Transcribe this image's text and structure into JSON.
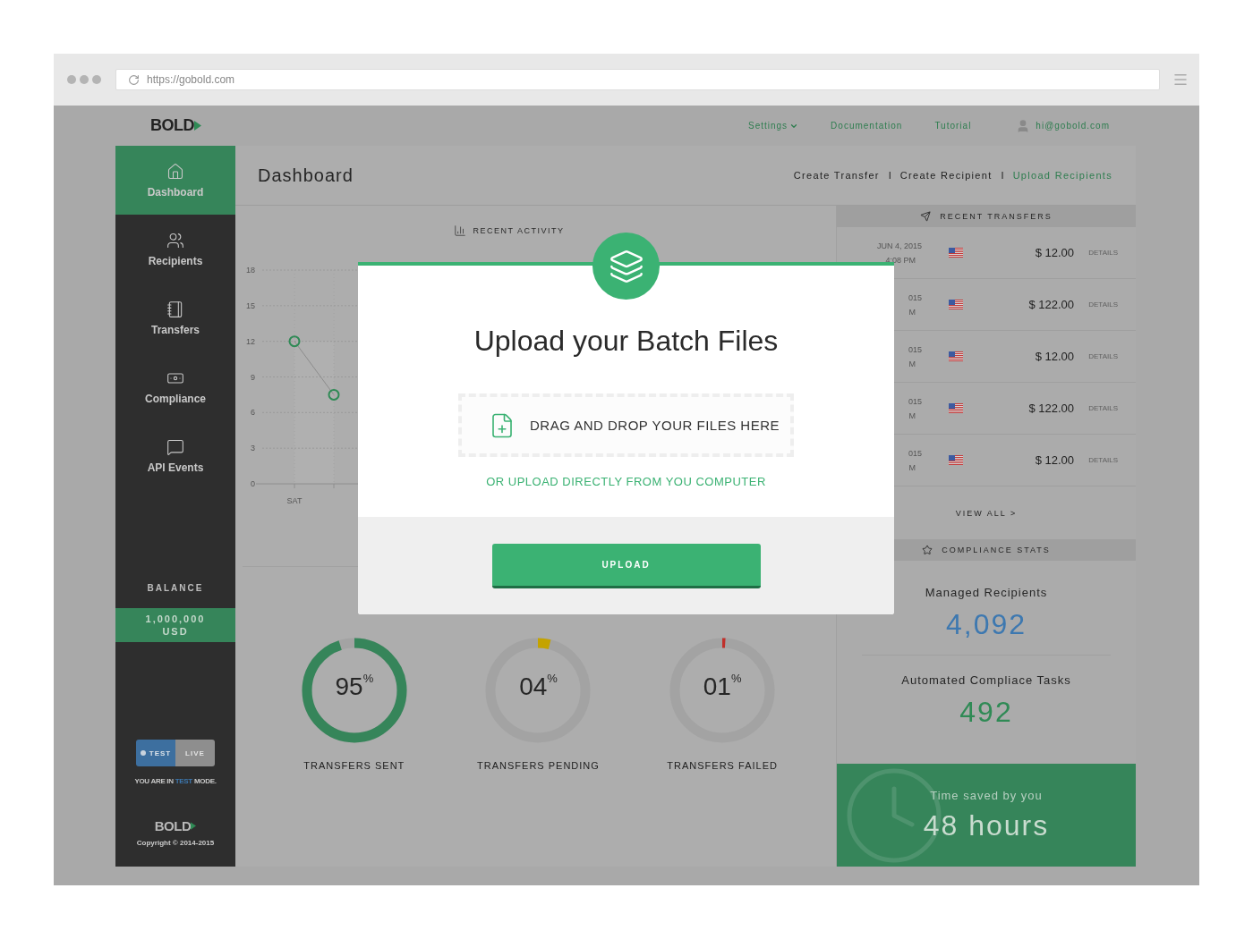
{
  "browser": {
    "url": "https://gobold.com"
  },
  "topbar": {
    "logo": "BOLD",
    "links": [
      {
        "label": "Settings",
        "kind": "dropdown"
      },
      {
        "label": "Documentation",
        "kind": "link"
      },
      {
        "label": "Tutorial",
        "kind": "link"
      }
    ],
    "user": "hi@gobold.com"
  },
  "sidebar": {
    "items": [
      {
        "label": "Dashboard",
        "selected": true
      },
      {
        "label": "Recipients",
        "selected": false
      },
      {
        "label": "Transfers",
        "selected": false
      },
      {
        "label": "Compliance",
        "selected": false
      },
      {
        "label": "API Events",
        "selected": false
      }
    ],
    "balance_label": "BALANCE",
    "balance_value": "1,000,000",
    "balance_currency": "USD",
    "mode_toggle": [
      {
        "label": "TEST",
        "selected": true
      },
      {
        "label": "LIVE",
        "selected": false
      }
    ],
    "mode_text": {
      "before": "YOU ARE IN ",
      "highlight": "TEST",
      "after": " MODE."
    },
    "footer_logo": "BOLD",
    "copyright": "Copyright © 2014-2015"
  },
  "header": {
    "title": "Dashboard",
    "separators": [
      "I",
      "I"
    ],
    "actions": [
      {
        "label": "Create Transfer",
        "selected": false
      },
      {
        "label": "Create Recipient",
        "selected": false
      },
      {
        "label": "Upload Recipients",
        "selected": true
      }
    ]
  },
  "activity": {
    "title": "RECENT ACTIVITY",
    "y_labels": [
      "18",
      "15",
      "12",
      "9",
      "6",
      "3",
      "0"
    ],
    "x_labels": [
      "SAT"
    ]
  },
  "gauges": [
    {
      "value": "95$^{%}$",
      "label": "TRANSFERS SENT",
      "level": 0.95,
      "color": "#36855a"
    },
    {
      "value": "04$^{%}$",
      "label": "TRANSFERS PENDING",
      "level": 0.04,
      "color": "#c4a300"
    },
    {
      "value": "01$^{%}$",
      "label": "TRANSFERS FAILED",
      "level": 0.01,
      "color": "#c0302b"
    }
  ],
  "recent_transfers": {
    "title": "RECENT TRANSFERS",
    "rows": [
      {
        "date": "JUN 4, 2015",
        "time": "4:08 PM",
        "amount": "$ 12.00",
        "action": "DETAILS"
      },
      {
        "date": "015",
        "time": "M",
        "amount": "$ 122.00",
        "action": "DETAILS"
      },
      {
        "date": "015",
        "time": "M",
        "amount": "$ 12.00",
        "action": "DETAILS"
      },
      {
        "date": "015",
        "time": "M",
        "amount": "$ 122.00",
        "action": "DETAILS"
      },
      {
        "date": "015",
        "time": "M",
        "amount": "$ 12.00",
        "action": "DETAILS"
      }
    ],
    "view_all": "VIEW ALL >"
  },
  "compliance": {
    "title": "COMPLIANCE STATS",
    "stats": [
      {
        "label": "Managed Recipients",
        "value": "4,092",
        "color": "#3d78b0"
      },
      {
        "label": "Automated Compliace Tasks",
        "value": "492",
        "color": "#2f8a55"
      }
    ]
  },
  "time_saved": {
    "label": "Time saved by you",
    "value": "48 hours"
  },
  "modal": {
    "title": "Upload your Batch Files",
    "dropzone": "DRAG AND DROP YOUR FILES HERE",
    "link": "OR UPLOAD DIRECTLY FROM YOU COMPUTER",
    "button": "UPLOAD"
  }
}
